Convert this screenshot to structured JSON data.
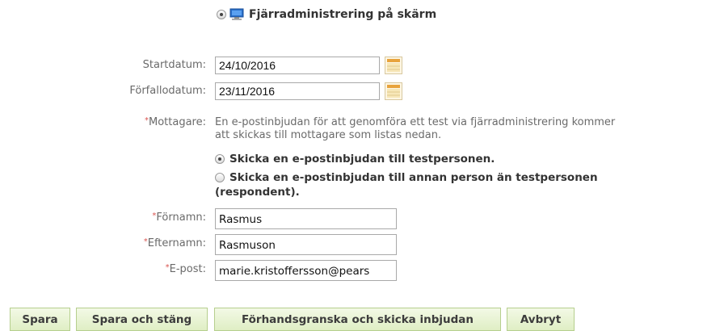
{
  "remote_admin_option": {
    "label": "Fjärradministrering på skärm",
    "selected": true,
    "icon": "monitor-icon"
  },
  "form": {
    "start_date": {
      "label": "Startdatum:",
      "value": "24/10/2016"
    },
    "due_date": {
      "label": "Förfallodatum:",
      "value": "23/11/2016"
    },
    "recipient": {
      "required_mark": "*",
      "label": "Mottagare:",
      "message_line1": "En e-postinbjudan för att genomföra ett test via fjärradministrering kommer",
      "message_line2": "att skickas till mottagare som listas nedan."
    },
    "invite_options": [
      {
        "label": "Skicka en e-postinbjudan till testpersonen.",
        "selected": true
      },
      {
        "label_line1": "Skicka en e-postinbjudan till annan person än testpersonen",
        "label_line2": "(respondent).",
        "selected": false
      }
    ],
    "first_name": {
      "required_mark": "*",
      "label": "Förnamn:",
      "value": "Rasmus"
    },
    "last_name": {
      "required_mark": "*",
      "label": "Efternamn:",
      "value": "Rasmuson"
    },
    "email": {
      "required_mark": "*",
      "label": "E-post:",
      "value": "marie.kristoffersson@pears"
    }
  },
  "buttons": {
    "save": "Spara",
    "save_close": "Spara och stäng",
    "preview_send": "Förhandsgranska och skicka inbjudan",
    "cancel": "Avbryt"
  },
  "colors": {
    "button_border": "#b6cf8e",
    "button_bg": "#e7f2d2",
    "required": "#d9534f",
    "calendar": "#f0c060"
  }
}
